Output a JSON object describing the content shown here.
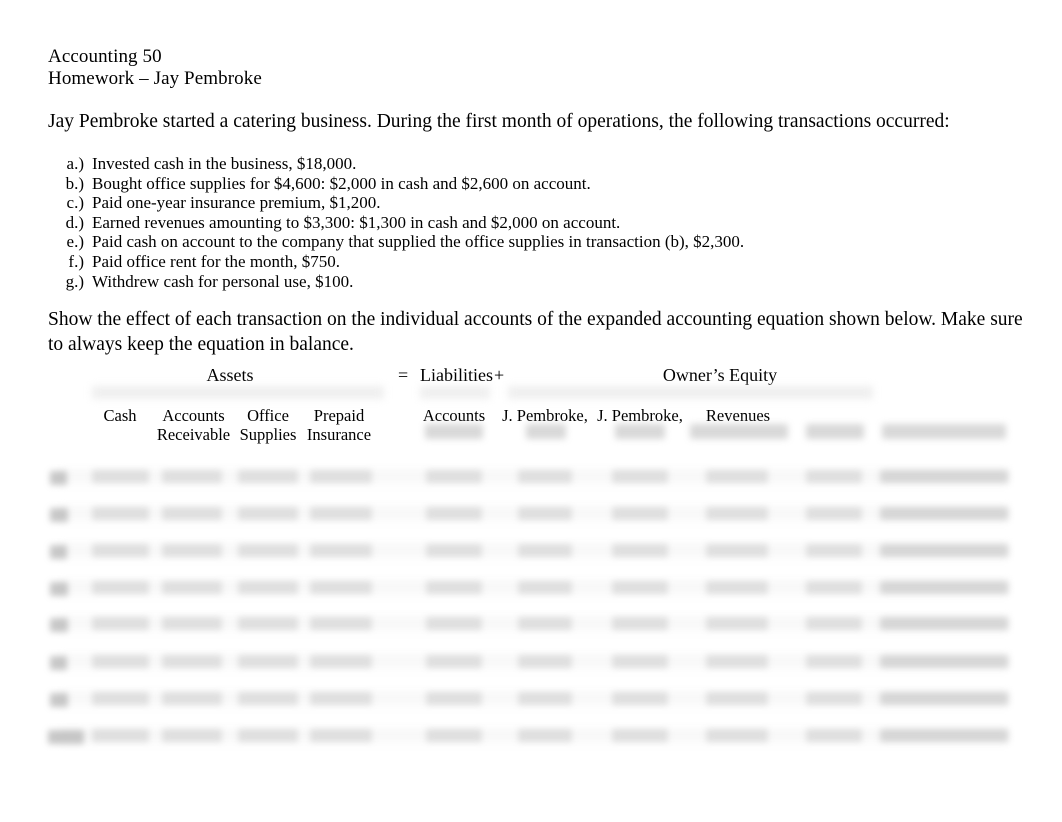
{
  "document": {
    "course": "Accounting 50",
    "assignment": "Homework  – Jay Pembroke",
    "intro": "Jay Pembroke started a catering business.  During the first month of operations, the following transactions occurred:",
    "instruction": "Show the effect of each transaction on the individual accounts of the expanded accounting equation shown below.  Make sure to always keep the equation in balance."
  },
  "transactions": [
    {
      "key": "a.)",
      "text": "Invested cash in the business, $18,000."
    },
    {
      "key": "b.)",
      "text": "Bought office supplies for $4,600:  $2,000 in cash and $2,600 on account."
    },
    {
      "key": "c.)",
      "text": "Paid one-year insurance premium, $1,200."
    },
    {
      "key": "d.)",
      "text": "Earned revenues amounting to $3,300:  $1,300 in cash and $2,000 on account."
    },
    {
      "key": "e.)",
      "text": "Paid cash on account to the company that supplied the office supplies in transaction (b), $2,300."
    },
    {
      "key": "f.)",
      "text": "Paid office rent for the month, $750."
    },
    {
      "key": "g.)",
      "text": "Withdrew cash for personal use, $100."
    }
  ],
  "worksheet": {
    "equation": {
      "assets": "Assets",
      "equals": "=",
      "liabilities": "Liabilities",
      "plus": "+",
      "owners_equity": "Owner’s Equity"
    },
    "columns": [
      {
        "line1": "",
        "line2": "Cash"
      },
      {
        "line1": "Accounts",
        "line2": "Receivable"
      },
      {
        "line1": "Office",
        "line2": "Supplies"
      },
      {
        "line1": "Prepaid",
        "line2": "Insurance"
      },
      {
        "line1": "Accounts",
        "line2": ""
      },
      {
        "line1": "J. Pembroke,",
        "line2": ""
      },
      {
        "line1": "J. Pembroke,",
        "line2": ""
      },
      {
        "line1": "Revenues",
        "line2": ""
      }
    ],
    "redacted_note": "worksheet cells are blurred and illegible in the source image",
    "row_count": 8,
    "column_count": 10
  }
}
